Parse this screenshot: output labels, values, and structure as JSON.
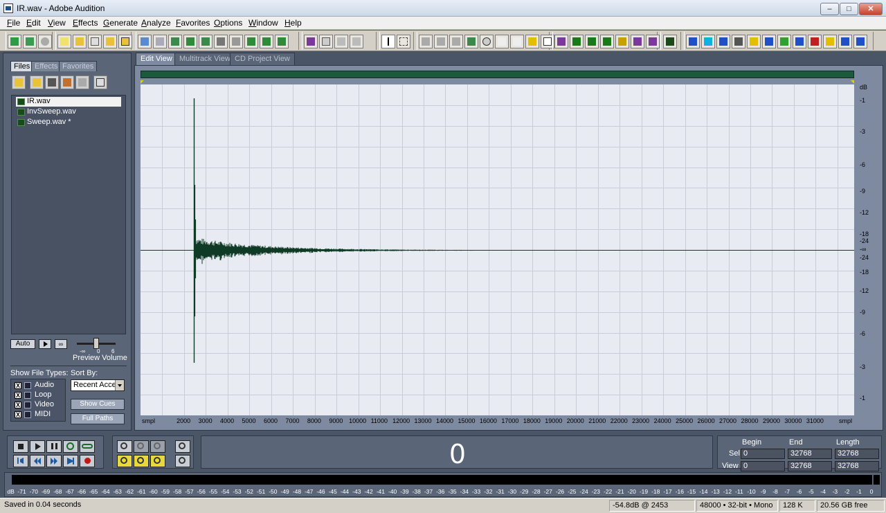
{
  "window": {
    "title": "IR.wav - Adobe Audition",
    "min": "–",
    "max": "□",
    "close": "✕"
  },
  "menu": [
    "File",
    "Edit",
    "View",
    "Effects",
    "Generate",
    "Analyze",
    "Favorites",
    "Options",
    "Window",
    "Help"
  ],
  "left_panel": {
    "tabs": [
      "Files",
      "Effects",
      "Favorites"
    ],
    "files": [
      {
        "name": "IR.wav",
        "selected": true
      },
      {
        "name": "InvSweep.wav",
        "selected": false
      },
      {
        "name": "Sweep.wav *",
        "selected": false
      }
    ],
    "auto_label": "Auto",
    "loop_label": "∞",
    "volume_min": "-∞",
    "volume_zero": "0",
    "volume_max": "6",
    "preview_volume_label": "Preview Volume",
    "show_file_types_label": "Show File Types:",
    "sort_by_label": "Sort By:",
    "file_types": [
      {
        "label": "Audio",
        "checked": "X"
      },
      {
        "label": "Loop",
        "checked": "X"
      },
      {
        "label": "Video",
        "checked": "X"
      },
      {
        "label": "MIDI",
        "checked": "X"
      }
    ],
    "sort_value": "Recent Acce",
    "show_cues_label": "Show Cues",
    "full_paths_label": "Full Paths"
  },
  "main_tabs": [
    "Edit View",
    "Multitrack View",
    "CD Project View"
  ],
  "db_scale": {
    "unit": "dB",
    "labels": [
      "-1",
      "-3",
      "-6",
      "-9",
      "-12",
      "-18",
      "-24",
      "-∞",
      "-24",
      "-18",
      "-12",
      "-9",
      "-6",
      "-3",
      "-1"
    ]
  },
  "time_ruler": {
    "start_label": "smpl",
    "end_label": "smpl",
    "ticks": [
      2000,
      3000,
      4000,
      5000,
      6000,
      7000,
      8000,
      9000,
      10000,
      11000,
      12000,
      13000,
      14000,
      15000,
      16000,
      17000,
      18000,
      19000,
      20000,
      21000,
      22000,
      23000,
      24000,
      25000,
      26000,
      27000,
      28000,
      29000,
      30000,
      31000
    ],
    "total_samples": 32768
  },
  "waveform": {
    "color": "#0f3b26",
    "impulse_sample": 2453
  },
  "time_display": "0",
  "selection": {
    "headers": [
      "Begin",
      "End",
      "Length"
    ],
    "sel_label": "Sel",
    "view_label": "View",
    "sel": [
      "0",
      "32768",
      "32768"
    ],
    "view": [
      "0",
      "32768",
      "32768"
    ]
  },
  "meter_labels": [
    "dB",
    "-71",
    "-70",
    "-69",
    "-68",
    "-67",
    "-66",
    "-65",
    "-64",
    "-63",
    "-62",
    "-61",
    "-60",
    "-59",
    "-58",
    "-57",
    "-56",
    "-55",
    "-54",
    "-53",
    "-52",
    "-51",
    "-50",
    "-49",
    "-48",
    "-47",
    "-46",
    "-45",
    "-44",
    "-43",
    "-42",
    "-41",
    "-40",
    "-39",
    "-38",
    "-37",
    "-36",
    "-35",
    "-34",
    "-33",
    "-32",
    "-31",
    "-30",
    "-29",
    "-28",
    "-27",
    "-26",
    "-25",
    "-24",
    "-23",
    "-22",
    "-21",
    "-20",
    "-19",
    "-18",
    "-17",
    "-16",
    "-15",
    "-14",
    "-13",
    "-12",
    "-11",
    "-10",
    "-9",
    "-8",
    "-7",
    "-6",
    "-5",
    "-4",
    "-3",
    "-2",
    "-1",
    "0"
  ],
  "status": {
    "message": "Saved in 0.04 seconds",
    "peak": "-54.8dB @ 2453",
    "format": "48000 • 32-bit • Mono",
    "size": "128 K",
    "free": "20.56 GB free"
  }
}
